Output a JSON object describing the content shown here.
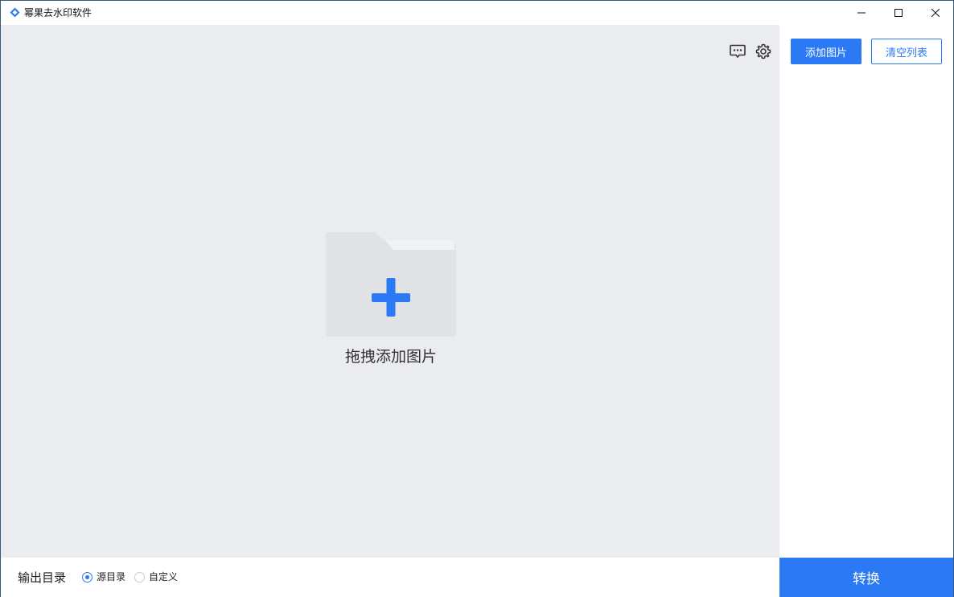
{
  "window": {
    "title": "幂果去水印软件",
    "app_icon": "app-logo-icon",
    "controls": [
      "minimize-icon",
      "maximize-icon",
      "close-icon"
    ]
  },
  "toolbar": {
    "icons": [
      "feedback-icon",
      "gear-icon"
    ]
  },
  "drop_zone": {
    "label": "拖拽添加图片",
    "icon": "folder-plus-icon"
  },
  "right_panel": {
    "add_button": "添加图片",
    "clear_button": "清空列表"
  },
  "bottom": {
    "output_label": "输出目录",
    "options": [
      {
        "label": "源目录",
        "selected": true
      },
      {
        "label": "自定义",
        "selected": false
      }
    ],
    "convert_button": "转换"
  },
  "colors": {
    "accent": "#2b79f4",
    "drop_bg": "#ebecf0",
    "folder": "#e1e2e6"
  }
}
